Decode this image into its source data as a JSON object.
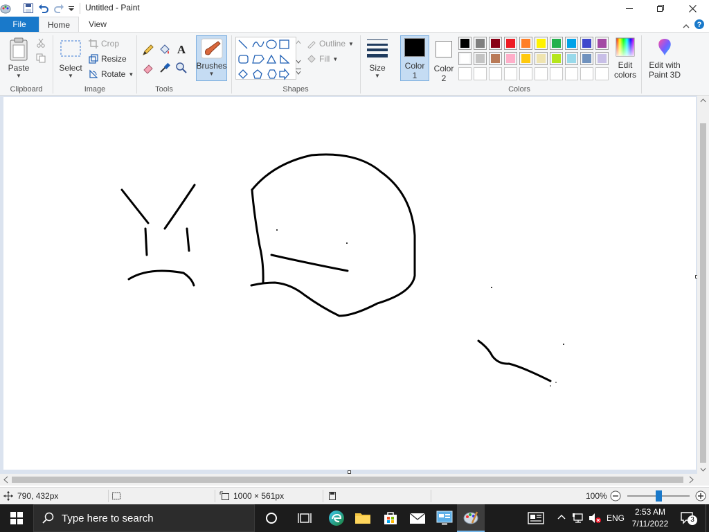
{
  "titlebar": {
    "title": "Untitled - Paint",
    "icons": [
      "paint-app-icon",
      "save-icon",
      "undo-icon",
      "redo-icon",
      "customize-qat-icon"
    ],
    "window_buttons": [
      "minimize-icon",
      "restore-icon",
      "close-icon"
    ]
  },
  "tabs": {
    "file": "File",
    "home": "Home",
    "view": "View"
  },
  "ribbon": {
    "clipboard": {
      "paste": "Paste",
      "label": "Clipboard"
    },
    "image": {
      "select": "Select",
      "crop": "Crop",
      "resize": "Resize",
      "rotate": "Rotate",
      "label": "Image"
    },
    "tools": {
      "label": "Tools"
    },
    "brushes": {
      "label": "Brushes"
    },
    "shapes": {
      "outline": "Outline",
      "fill": "Fill",
      "label": "Shapes"
    },
    "size": {
      "label": "Size"
    },
    "colors": {
      "color1": "Color",
      "color1_num": "1",
      "color2": "Color",
      "color2_num": "2",
      "edit_colors": "Edit",
      "edit_colors2": "colors",
      "paint3d": "Edit with",
      "paint3d2": "Paint 3D",
      "label": "Colors",
      "color1_value": "#000000",
      "color2_value": "#ffffff",
      "palette_row1": [
        "#000000",
        "#7f7f7f",
        "#880015",
        "#ed1c24",
        "#ff7f27",
        "#fff200",
        "#22b14c",
        "#00a2e8",
        "#3f48cc",
        "#a349a4"
      ],
      "palette_row2": [
        "#ffffff",
        "#c3c3c3",
        "#b97a57",
        "#ffaec9",
        "#ffc90e",
        "#efe4b0",
        "#b5e61d",
        "#99d9ea",
        "#7092be",
        "#c8bfe7"
      ]
    }
  },
  "status": {
    "cursor_pos": "790, 432px",
    "canvas_size": "1000 × 561px",
    "zoom": "100%",
    "zoom_fraction": 0.5
  },
  "taskbar": {
    "search_placeholder": "Type here to search",
    "lang": "ENG",
    "time": "2:53 AM",
    "date": "7/11/2022",
    "notifications": "3"
  }
}
